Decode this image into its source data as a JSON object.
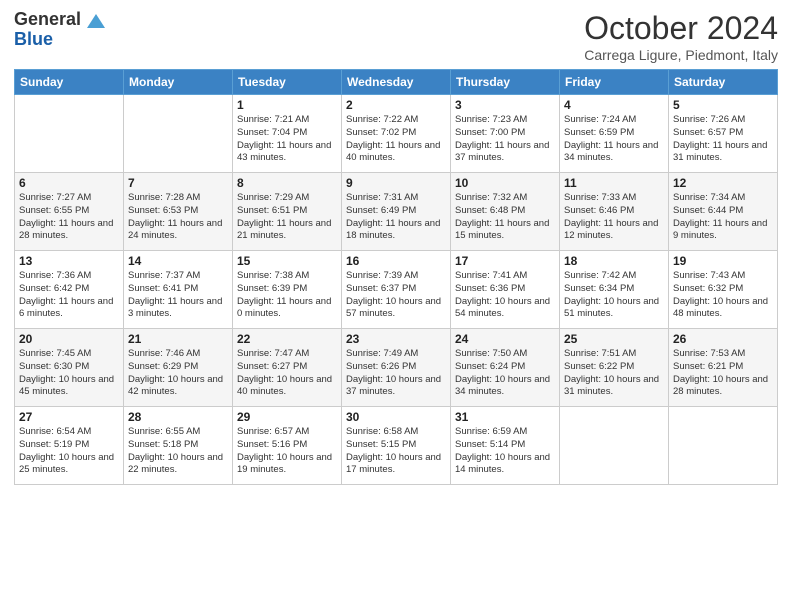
{
  "header": {
    "logo_general": "General",
    "logo_blue": "Blue",
    "month_title": "October 2024",
    "location": "Carrega Ligure, Piedmont, Italy"
  },
  "weekdays": [
    "Sunday",
    "Monday",
    "Tuesday",
    "Wednesday",
    "Thursday",
    "Friday",
    "Saturday"
  ],
  "weeks": [
    [
      {
        "day": "",
        "info": ""
      },
      {
        "day": "",
        "info": ""
      },
      {
        "day": "1",
        "info": "Sunrise: 7:21 AM\nSunset: 7:04 PM\nDaylight: 11 hours and 43 minutes."
      },
      {
        "day": "2",
        "info": "Sunrise: 7:22 AM\nSunset: 7:02 PM\nDaylight: 11 hours and 40 minutes."
      },
      {
        "day": "3",
        "info": "Sunrise: 7:23 AM\nSunset: 7:00 PM\nDaylight: 11 hours and 37 minutes."
      },
      {
        "day": "4",
        "info": "Sunrise: 7:24 AM\nSunset: 6:59 PM\nDaylight: 11 hours and 34 minutes."
      },
      {
        "day": "5",
        "info": "Sunrise: 7:26 AM\nSunset: 6:57 PM\nDaylight: 11 hours and 31 minutes."
      }
    ],
    [
      {
        "day": "6",
        "info": "Sunrise: 7:27 AM\nSunset: 6:55 PM\nDaylight: 11 hours and 28 minutes."
      },
      {
        "day": "7",
        "info": "Sunrise: 7:28 AM\nSunset: 6:53 PM\nDaylight: 11 hours and 24 minutes."
      },
      {
        "day": "8",
        "info": "Sunrise: 7:29 AM\nSunset: 6:51 PM\nDaylight: 11 hours and 21 minutes."
      },
      {
        "day": "9",
        "info": "Sunrise: 7:31 AM\nSunset: 6:49 PM\nDaylight: 11 hours and 18 minutes."
      },
      {
        "day": "10",
        "info": "Sunrise: 7:32 AM\nSunset: 6:48 PM\nDaylight: 11 hours and 15 minutes."
      },
      {
        "day": "11",
        "info": "Sunrise: 7:33 AM\nSunset: 6:46 PM\nDaylight: 11 hours and 12 minutes."
      },
      {
        "day": "12",
        "info": "Sunrise: 7:34 AM\nSunset: 6:44 PM\nDaylight: 11 hours and 9 minutes."
      }
    ],
    [
      {
        "day": "13",
        "info": "Sunrise: 7:36 AM\nSunset: 6:42 PM\nDaylight: 11 hours and 6 minutes."
      },
      {
        "day": "14",
        "info": "Sunrise: 7:37 AM\nSunset: 6:41 PM\nDaylight: 11 hours and 3 minutes."
      },
      {
        "day": "15",
        "info": "Sunrise: 7:38 AM\nSunset: 6:39 PM\nDaylight: 11 hours and 0 minutes."
      },
      {
        "day": "16",
        "info": "Sunrise: 7:39 AM\nSunset: 6:37 PM\nDaylight: 10 hours and 57 minutes."
      },
      {
        "day": "17",
        "info": "Sunrise: 7:41 AM\nSunset: 6:36 PM\nDaylight: 10 hours and 54 minutes."
      },
      {
        "day": "18",
        "info": "Sunrise: 7:42 AM\nSunset: 6:34 PM\nDaylight: 10 hours and 51 minutes."
      },
      {
        "day": "19",
        "info": "Sunrise: 7:43 AM\nSunset: 6:32 PM\nDaylight: 10 hours and 48 minutes."
      }
    ],
    [
      {
        "day": "20",
        "info": "Sunrise: 7:45 AM\nSunset: 6:30 PM\nDaylight: 10 hours and 45 minutes."
      },
      {
        "day": "21",
        "info": "Sunrise: 7:46 AM\nSunset: 6:29 PM\nDaylight: 10 hours and 42 minutes."
      },
      {
        "day": "22",
        "info": "Sunrise: 7:47 AM\nSunset: 6:27 PM\nDaylight: 10 hours and 40 minutes."
      },
      {
        "day": "23",
        "info": "Sunrise: 7:49 AM\nSunset: 6:26 PM\nDaylight: 10 hours and 37 minutes."
      },
      {
        "day": "24",
        "info": "Sunrise: 7:50 AM\nSunset: 6:24 PM\nDaylight: 10 hours and 34 minutes."
      },
      {
        "day": "25",
        "info": "Sunrise: 7:51 AM\nSunset: 6:22 PM\nDaylight: 10 hours and 31 minutes."
      },
      {
        "day": "26",
        "info": "Sunrise: 7:53 AM\nSunset: 6:21 PM\nDaylight: 10 hours and 28 minutes."
      }
    ],
    [
      {
        "day": "27",
        "info": "Sunrise: 6:54 AM\nSunset: 5:19 PM\nDaylight: 10 hours and 25 minutes."
      },
      {
        "day": "28",
        "info": "Sunrise: 6:55 AM\nSunset: 5:18 PM\nDaylight: 10 hours and 22 minutes."
      },
      {
        "day": "29",
        "info": "Sunrise: 6:57 AM\nSunset: 5:16 PM\nDaylight: 10 hours and 19 minutes."
      },
      {
        "day": "30",
        "info": "Sunrise: 6:58 AM\nSunset: 5:15 PM\nDaylight: 10 hours and 17 minutes."
      },
      {
        "day": "31",
        "info": "Sunrise: 6:59 AM\nSunset: 5:14 PM\nDaylight: 10 hours and 14 minutes."
      },
      {
        "day": "",
        "info": ""
      },
      {
        "day": "",
        "info": ""
      }
    ]
  ]
}
